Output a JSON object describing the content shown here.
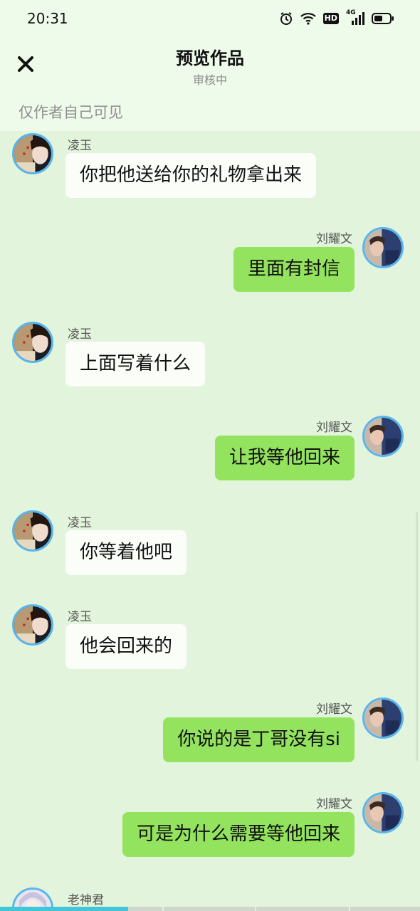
{
  "status_bar": {
    "time": "20:31",
    "hd_label": "HD",
    "network_label": "4G"
  },
  "header": {
    "title": "预览作品",
    "subtitle": "审核中",
    "close_icon": "close-icon"
  },
  "notice": "仅作者自己可见",
  "messages": [
    {
      "side": "left",
      "sender": "凌玉",
      "text": "你把他送给你的礼物拿出来"
    },
    {
      "side": "right",
      "sender": "刘耀文",
      "text": "里面有封信"
    },
    {
      "side": "left",
      "sender": "凌玉",
      "text": "上面写着什么"
    },
    {
      "side": "right",
      "sender": "刘耀文",
      "text": "让我等他回来"
    },
    {
      "side": "left",
      "sender": "凌玉",
      "text": "你等着他吧"
    },
    {
      "side": "left",
      "sender": "凌玉",
      "text": "他会回来的"
    },
    {
      "side": "right",
      "sender": "刘耀文",
      "text": "你说的是丁哥没有si"
    },
    {
      "side": "right",
      "sender": "刘耀文",
      "text": "可是为什么需要等他回来"
    },
    {
      "side": "left",
      "sender": "老神君",
      "text": ""
    }
  ],
  "colors": {
    "left_bubble": "#fafdf8",
    "right_bubble": "#93e35f",
    "avatar_border": "#58b6ec",
    "background": "#e3f4dc"
  }
}
